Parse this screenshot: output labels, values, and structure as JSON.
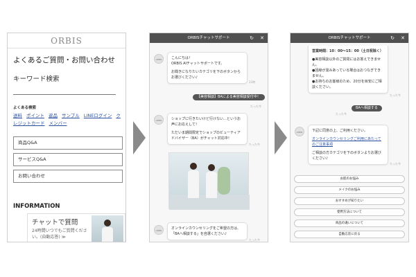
{
  "screen1": {
    "logo": "ORBIS",
    "title": "よくあるご質問・お問い合わせ",
    "keyword_label": "キーワード検索",
    "small_label": "よくある検索",
    "links": [
      "送料",
      "ポイント",
      "返品",
      "サンプル",
      "LINEログイン",
      "クレジットカード",
      "メンバー"
    ],
    "buttons": [
      "商品Q&A",
      "サービスQ&A",
      "お問い合わせ"
    ],
    "info_heading": "INFORMATION",
    "chat_popup": {
      "title": "チャットで質問",
      "sub": "24時間いつでもご質問ください。(自動応答)",
      "arrow": "≫"
    }
  },
  "screen2": {
    "header": "ORBISチャットサポート",
    "avatar_label": "ORBIS",
    "bubble1": [
      "こんにちは！",
      "ORBIS AIチャットサポートです。",
      "",
      "お聞きになりたいカテゴリを下のボタンからお選びください♪"
    ],
    "ts1": "22時",
    "user_msg": "【美容相談】BAによる美容相談受付中！",
    "ts2": "たった今",
    "bubble2": [
      "ショップに行きたいけど行けない…というお声にお応えして！",
      "",
      "ただいま期間限定でショップのビューティアドバイザー（BA）がチャット対応中！"
    ],
    "ts3": "たった今",
    "bubble3": [
      "オンラインカウンセリングをご希望の方は、「BAへ相談する」を自選ください♪"
    ],
    "ts4": "たった今"
  },
  "screen3": {
    "header": "ORBISチャットサポート",
    "avatar_label": "ORBIS",
    "bubble1": [
      "営業時間：10：00〜15：00（土日祝除く）",
      "",
      "●美容相談以外のご質問にはお答えできません。",
      "●回線が混みあっている場合はおつなぎできません。",
      "●お持ちのお客様のため、20分を目安にご相談ください。"
    ],
    "ts1": "たった今",
    "user_msg": "BAへ相談する",
    "ts2": "たった今",
    "bubble2_a": "下記に同意の上、ご利用ください。",
    "bubble2_link": "オンラインカウンセリングご利用にあたってのご注意事項",
    "bubble2_b": "ご相談の方カテゴリを下のボタンよりお選びください♪",
    "ts3": "たった今",
    "options": [
      "お肌のお悩み",
      "メイクのお悩み",
      "おすすめが知りたい",
      "使用方法について",
      "商品の違いについて",
      "自動応答に戻る"
    ]
  },
  "icons": {
    "reload": "reload-icon",
    "close": "close-icon"
  }
}
